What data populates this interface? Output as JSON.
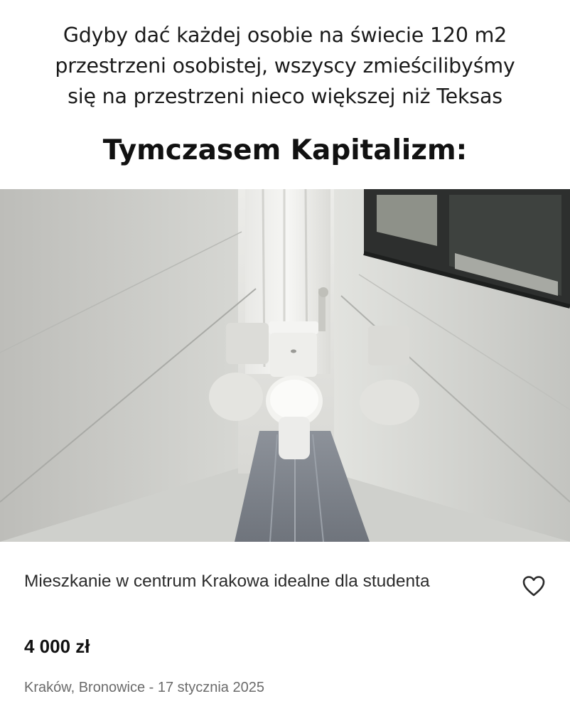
{
  "meme": {
    "top_text_lines": [
      "Gdyby dać każdej osobie na świecie 120 m2",
      "przestrzeni osobistej, wszyscy zmieścilibyśmy",
      "się na przestrzeni nieco większej niż Teksas"
    ],
    "headline": "Tymczasem Kapitalizm:"
  },
  "photo": {
    "icon": "bathroom-photo"
  },
  "listing": {
    "title": "Mieszkanie w centrum Krakowa idealne dla studenta",
    "price": "4 000 zł",
    "location_date": "Kraków, Bronowice - 17 stycznia 2025",
    "favorite_icon": "heart-outline-icon"
  }
}
